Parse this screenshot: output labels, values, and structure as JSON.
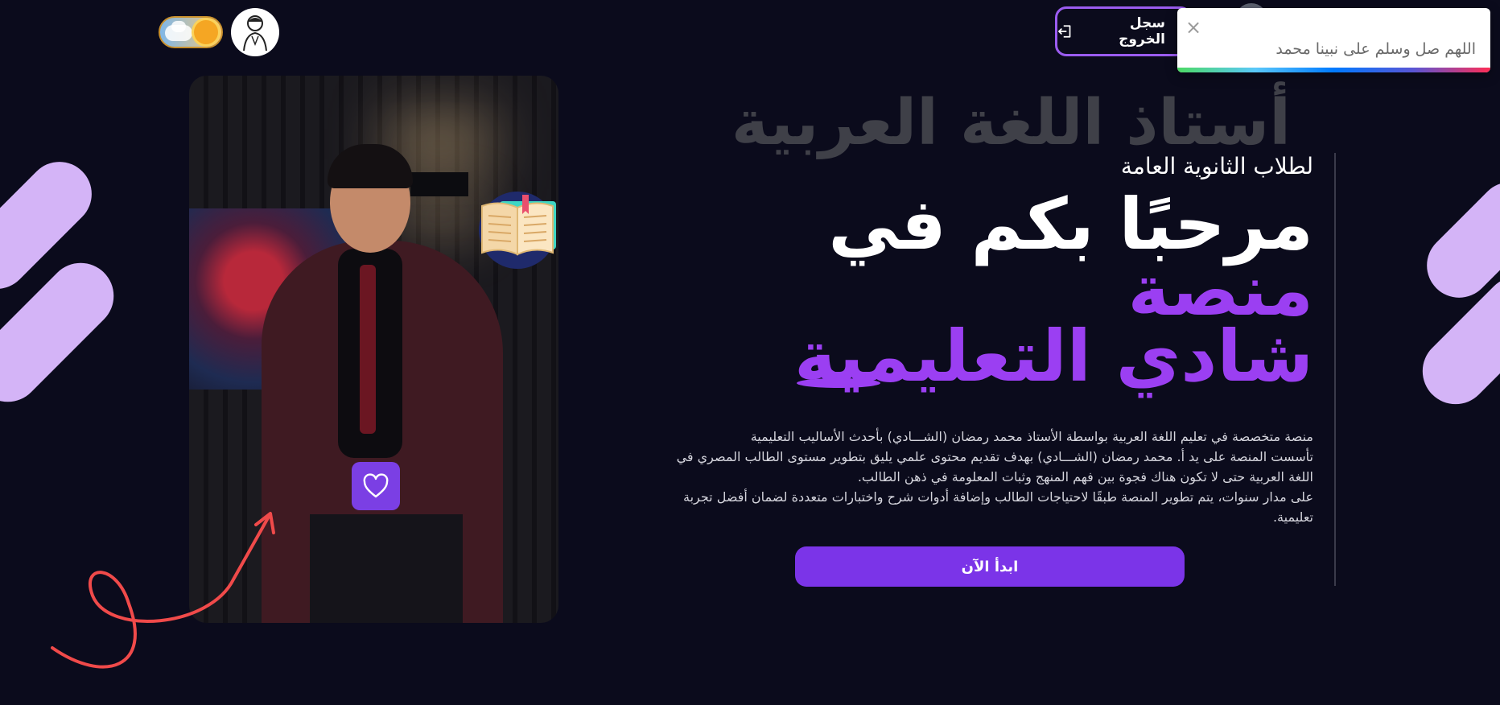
{
  "header": {
    "logout_label": "سجل الخروج",
    "theme_toggle_state": "light",
    "logo_name": "shady-logo"
  },
  "toast": {
    "message": "اللهم صل وسلم على نبينا محمد",
    "close_symbol": "×"
  },
  "hero": {
    "ghost_title": "أستاذ اللغة العربية",
    "subtitle": "لطلاب الثانوية العامة",
    "title_white": "مرحبًا بكم في",
    "title_purple_1": "منصة",
    "title_purple_2": "شادي التعليمية",
    "description": [
      "منصة متخصصة في تعليم اللغة العربية بواسطة الأستاذ محمد رمضان (الشـــادي) بأحدث الأساليب التعليمية",
      "تأسست المنصة على يد أ. محمد رمضان (الشـــادي) بهدف تقديم محتوى علمي يليق بتطوير مستوى الطالب المصري في اللغة العربية حتى لا تكون هناك فجوة بين فهم المنهج وثبات المعلومة في ذهن الطالب.",
      "على مدار سنوات، يتم تطوير المنصة طبقًا لاحتياجات الطالب وإضافة أدوات شرح واختبارات متعددة لضمان أفضل تجربة تعليمية."
    ],
    "cta_label": "ابدأ الآن"
  },
  "colors": {
    "background": "#0b0b1c",
    "accent": "#9b3ff2",
    "button": "#7b34e8",
    "pill": "#d4b4f7",
    "arrow": "#f04a4a"
  },
  "icons": [
    "logout-icon",
    "heart-icon",
    "book-icon",
    "sun-icon",
    "close-icon"
  ]
}
